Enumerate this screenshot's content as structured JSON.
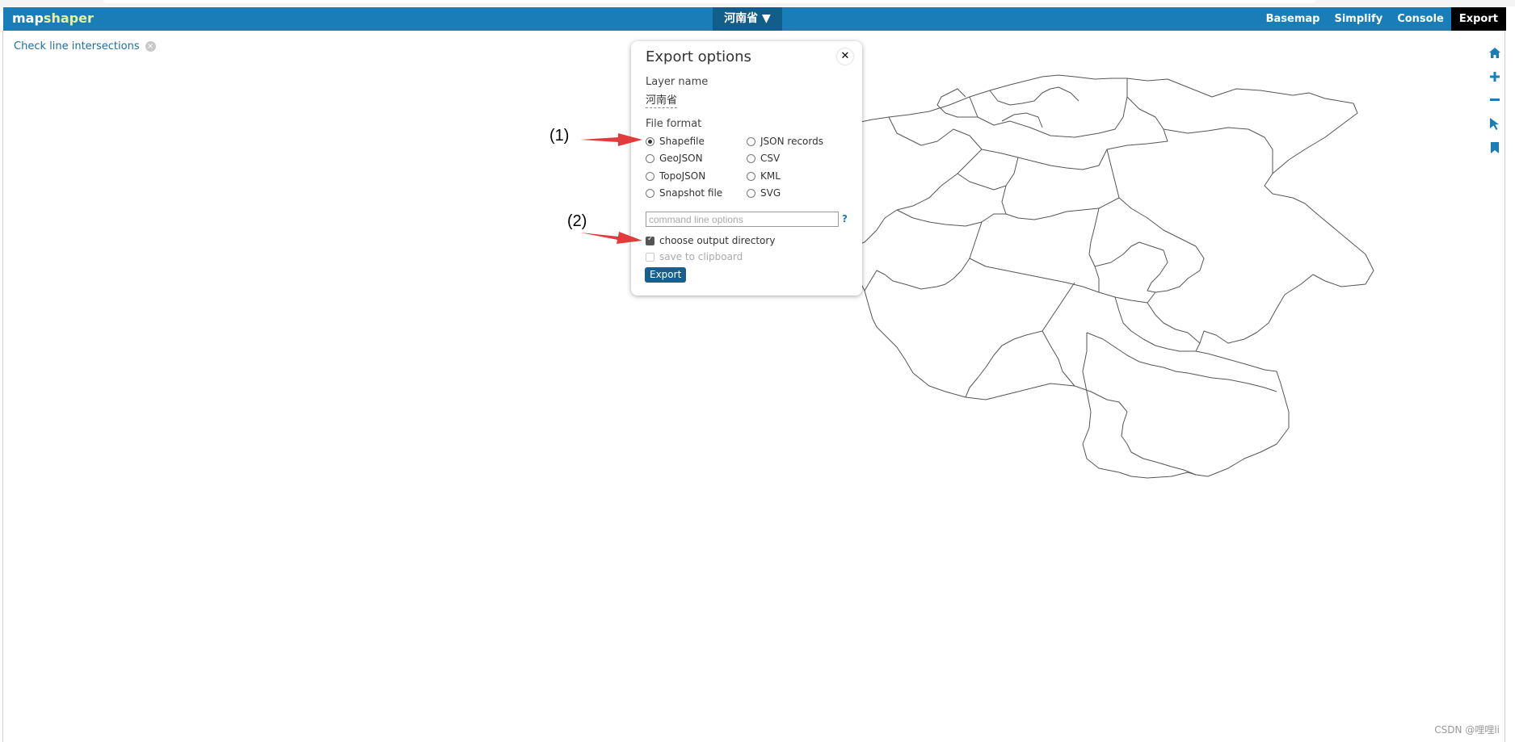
{
  "header": {
    "logo_prefix": "map",
    "logo_accent": "shaper",
    "layer_menu": "河南省 ▼",
    "nav": [
      "Basemap",
      "Simplify",
      "Console",
      "Export"
    ],
    "active_nav": "Export"
  },
  "notice": {
    "text": "Check line intersections",
    "close_glyph": "×"
  },
  "panel": {
    "title": "Export options",
    "close_glyph": "✕",
    "layer_name_label": "Layer name",
    "layer_name_value": "河南省",
    "file_format_label": "File format",
    "formats_left": [
      "Shapefile",
      "GeoJSON",
      "TopoJSON",
      "Snapshot file"
    ],
    "formats_right": [
      "JSON records",
      "CSV",
      "KML",
      "SVG"
    ],
    "selected_format": "Shapefile",
    "command_placeholder": "command line options",
    "help_glyph": "?",
    "checkbox_output_dir": "choose output directory",
    "checkbox_output_dir_checked": true,
    "checkbox_clipboard": "save to clipboard",
    "checkbox_clipboard_disabled": true,
    "export_button": "Export"
  },
  "annotations": {
    "label_1": "(1)",
    "label_2": "(2)",
    "arrow_color": "#e23b3b"
  },
  "tools": {
    "icons": [
      "home-icon",
      "zoom-in-icon",
      "zoom-out-icon",
      "pointer-icon",
      "bookmark-icon"
    ],
    "color": "#1a7db8"
  },
  "watermark": "CSDN @哩哩li",
  "colors": {
    "header_bg": "#1a7db8",
    "layer_menu_bg": "#135d8a",
    "link": "#1a6fa3",
    "map_stroke": "#555555"
  }
}
